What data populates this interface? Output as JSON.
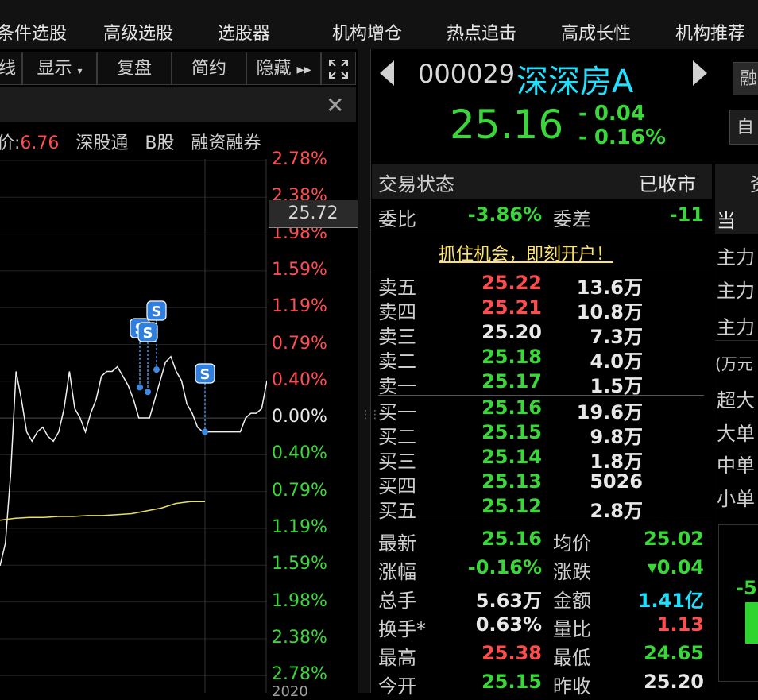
{
  "nav": [
    "条件选股",
    "高级选股",
    "选股器",
    "机构增仓",
    "热点追击",
    "高成长性",
    "机构推荐"
  ],
  "toolbar": {
    "left_fragment": "线",
    "display": "显示",
    "review": "复盘",
    "simple": "简约",
    "hide": "隐藏",
    "hide_arrows": "▸▸",
    "expand_icon": "expand-icon"
  },
  "chart_info": {
    "price_label_prefix": "价:",
    "price_value": "6.76",
    "tags": [
      "深股通",
      "B股",
      "融资融券"
    ],
    "cursor_price": "25.72",
    "bottom_fragment": "2020"
  },
  "chart_data": {
    "type": "line",
    "pct_labels_up": [
      "2.78%",
      "2.38%",
      "1.98%",
      "1.59%",
      "1.19%",
      "0.79%",
      "0.40%"
    ],
    "pct_zero": "0.00%",
    "pct_labels_down": [
      "0.40%",
      "0.79%",
      "1.19%",
      "1.59%",
      "1.98%",
      "2.38%",
      "2.78%"
    ],
    "ylim_pct": [
      -2.78,
      2.78
    ],
    "price_series_pct": [
      -1.59,
      -1.35,
      -0.6,
      0.5,
      0.2,
      -0.15,
      -0.25,
      -0.15,
      -0.1,
      -0.2,
      -0.25,
      -0.15,
      0.1,
      0.5,
      0.1,
      0.0,
      -0.15,
      0.05,
      0.2,
      0.45,
      0.5,
      0.5,
      0.55,
      0.45,
      0.35,
      0.2,
      0.0,
      0.0,
      0.0,
      0.2,
      0.4,
      0.6,
      0.66,
      0.5,
      0.4,
      0.15,
      0.05,
      -0.1,
      -0.15,
      -0.15,
      -0.15,
      -0.15,
      -0.15,
      -0.15,
      -0.15,
      -0.15,
      0.0,
      0.05,
      0.05,
      0.1,
      0.4
    ],
    "avg_series_pct": [
      -1.1,
      -1.08,
      -1.07,
      -1.07,
      -1.06,
      -1.06,
      -1.05,
      -1.05,
      -1.04,
      -1.03,
      -1.0,
      -0.97,
      -0.92,
      -0.9,
      -0.9
    ],
    "markers": [
      "S",
      "S",
      "S",
      "S"
    ]
  },
  "quote": {
    "code": "000029",
    "name": "深深房A",
    "price": "25.16",
    "change": "- 0.04",
    "change_pct": "- 0.16%",
    "right_btn_1": "融",
    "right_btn_2": "自"
  },
  "status": {
    "trade_label": "交易状态",
    "trade_value": "已收市",
    "ratio_label": "委比",
    "ratio_value": "-3.86%",
    "diff_label": "委差",
    "diff_value": "-11",
    "promo": "抓住机会，即刻开户！"
  },
  "sell_orders": [
    {
      "label": "卖五",
      "price": "25.22",
      "vol": "13.6万"
    },
    {
      "label": "卖四",
      "price": "25.21",
      "vol": "10.8万"
    },
    {
      "label": "卖三",
      "price": "25.20",
      "vol": "7.3万"
    },
    {
      "label": "卖二",
      "price": "25.18",
      "vol": "4.0万"
    },
    {
      "label": "卖一",
      "price": "25.17",
      "vol": "1.5万"
    }
  ],
  "buy_orders": [
    {
      "label": "买一",
      "price": "25.16",
      "vol": "19.6万"
    },
    {
      "label": "买二",
      "price": "25.15",
      "vol": "9.8万"
    },
    {
      "label": "买三",
      "price": "25.14",
      "vol": "1.8万"
    },
    {
      "label": "买四",
      "price": "25.13",
      "vol": "5026"
    },
    {
      "label": "买五",
      "price": "25.12",
      "vol": "2.8万"
    }
  ],
  "stats": [
    {
      "l1": "最新",
      "v1": "25.16",
      "l2": "均价",
      "v2": "25.02"
    },
    {
      "l1": "涨幅",
      "v1": "-0.16%",
      "l2": "涨跌",
      "v2": "▾0.04"
    },
    {
      "l1": "总手",
      "v1": "5.63万",
      "l2": "金额",
      "v2": "1.41亿"
    },
    {
      "l1": "换手*",
      "v1": "0.63%",
      "l2": "量比",
      "v2": "1.13"
    },
    {
      "l1": "最高",
      "v1": "25.38",
      "l2": "最低",
      "v2": "24.65"
    },
    {
      "l1": "今开",
      "v1": "25.15",
      "l2": "昨收",
      "v2": "25.20"
    }
  ],
  "right_panel": {
    "top_fragments": [
      "资",
      "当"
    ],
    "main_rows": [
      "主力",
      "主力",
      "主力"
    ],
    "unit": "(万元",
    "size_rows": [
      "超大",
      "大单",
      "中单",
      "小单"
    ],
    "bar_value": "-5"
  }
}
